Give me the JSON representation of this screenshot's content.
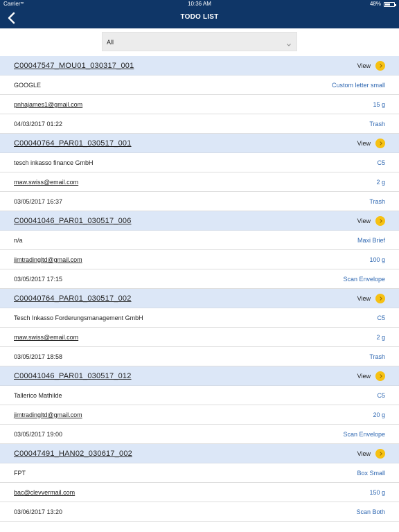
{
  "status": {
    "carrier": "Carrier",
    "time": "10:36 AM",
    "battery": "48%",
    "battery_level": 0.48
  },
  "header": {
    "title": "TODO LIST"
  },
  "filter": {
    "value": "All"
  },
  "view_label": "View",
  "items": [
    {
      "code": "C00047547_MOU01_030317_001",
      "name": "GOOGLE",
      "type": "Custom letter small",
      "email": "pnhajames1@gmail.com",
      "weight": "15 g",
      "date": "04/03/2017 01:22",
      "action": "Trash"
    },
    {
      "code": "C00040764_PAR01_030517_001",
      "name": "tesch inkasso finance GmbH",
      "type": "C5",
      "email": "maw.swiss@email.com",
      "weight": "2 g",
      "date": "03/05/2017 16:37",
      "action": "Trash"
    },
    {
      "code": "C00041046_PAR01_030517_006",
      "name": "n/a",
      "type": "Maxi Brief",
      "email": "jimtradingltd@gmail.com",
      "weight": "100 g",
      "date": "03/05/2017 17:15",
      "action": "Scan Envelope"
    },
    {
      "code": "C00040764_PAR01_030517_002",
      "name": "Tesch Inkasso Forderungsmanagement GmbH",
      "type": "C5",
      "email": "maw.swiss@email.com",
      "weight": "2 g",
      "date": "03/05/2017 18:58",
      "action": "Trash"
    },
    {
      "code": "C00041046_PAR01_030517_012",
      "name": "Tallerico Mathilde",
      "type": "C5",
      "email": "jimtradingltd@gmail.com",
      "weight": "20 g",
      "date": "03/05/2017 19:00",
      "action": "Scan Envelope"
    },
    {
      "code": "C00047491_HAN02_030617_002",
      "name": "FPT",
      "type": "Box Small",
      "email": "bac@clevvermail.com",
      "weight": "150 g",
      "date": "03/06/2017 13:20",
      "action": "Scan Both"
    }
  ]
}
